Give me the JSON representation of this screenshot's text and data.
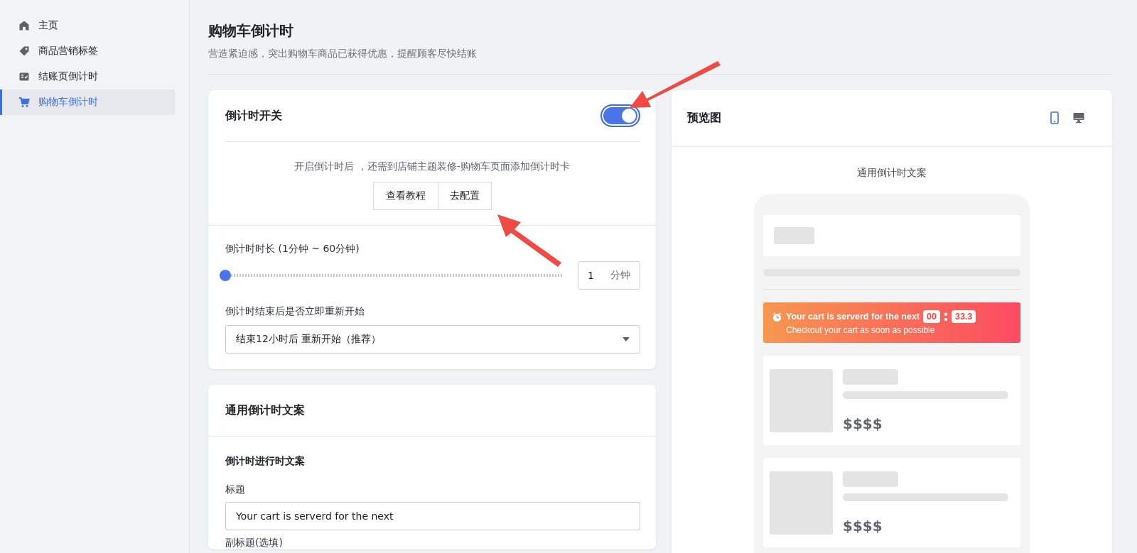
{
  "sidebar": {
    "items": [
      {
        "label": "主页",
        "selected": false
      },
      {
        "label": "商品营销标签",
        "selected": false
      },
      {
        "label": "结账页倒计时",
        "selected": false
      },
      {
        "label": "购物车倒计时",
        "selected": true
      }
    ]
  },
  "page": {
    "title": "购物车倒计时",
    "subtitle": "营造紧迫感，突出购物车商品已获得优惠，提醒顾客尽快结账"
  },
  "switch_card": {
    "title": "倒计时开关",
    "switch": {
      "on": true
    },
    "note": "开启倒计时后 ，还需到店铺主题装修-购物车页面添加倒计时卡",
    "buttons": [
      "查看教程",
      "去配置"
    ],
    "duration": {
      "label": "倒计时时长 (1分钟 ~ 60分钟)",
      "level": 0,
      "value": "1",
      "unit": "分钟"
    },
    "restart": {
      "label": "倒计时结束后是否立即重新开始",
      "value": "结束12小时后 重新开始（推荐）"
    }
  },
  "copy_card": {
    "title": "通用倒计时文案",
    "section_title": "倒计时进行时文案",
    "field": {
      "label": "标题",
      "value": "Your cart is serverd for the next"
    },
    "next_label": "副标题(选填)"
  },
  "preview": {
    "title": "预览图",
    "devices": [
      {
        "selected": true
      },
      {
        "selected": false
      }
    ],
    "caption": "通用倒计时文案",
    "banner": {
      "title": "Your cart is serverd for the next",
      "minutes": "00",
      "seconds": "33.3",
      "subtitle": "Checkout your cart as soon as possible"
    },
    "products": [
      {
        "price": "$$$$"
      },
      {
        "price": "$$$$"
      }
    ]
  }
}
